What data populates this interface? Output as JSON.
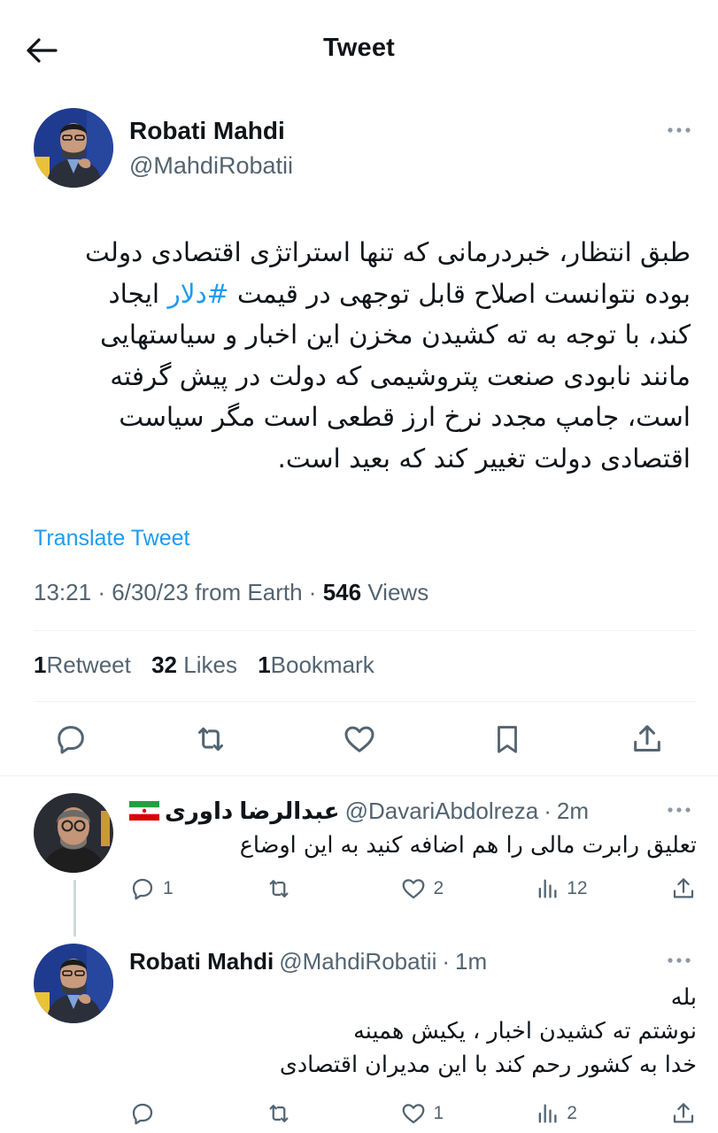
{
  "header": {
    "title": "Tweet",
    "back_icon": "arrow-left-icon"
  },
  "tweet": {
    "author": {
      "name": "Robati Mahdi",
      "handle": "@MahdiRobatii"
    },
    "text_lines": [
      "طبق انتظار، خبردرمانی که تنها استراتژی اقتصادی دولت",
      "بوده نتوانست اصلاح قابل توجهی در قیمت",
      "کند، با توجه به ته کشیدن مخزن این اخبار و سیاستهایی",
      "مانند نابودی صنعت پتروشیمی که دولت در پیش گرفته",
      "است، جامپ مجدد نرخ ارز قطعی است مگر سیاست",
      "اقتصادی دولت تغییر کند که بعید است."
    ],
    "hashtag": "#دلار",
    "line2_tail": "ایجاد",
    "translate_label": "Translate Tweet",
    "time": "13:21",
    "date": "6/30/23",
    "source": "from Earth",
    "views_count": "546",
    "views_label": "Views",
    "retweets_count": "1",
    "retweets_label": "Retweet",
    "likes_count": "32",
    "likes_label": "Likes",
    "bookmarks_count": "1",
    "bookmarks_label": "Bookmark"
  },
  "replies": [
    {
      "name": "عبدالرضا داوری",
      "handle": "@DavariAbdolreza",
      "time": "2m",
      "text_lines": [
        "تعلیق رابرت مالی را هم اضافه کنید به این اوضاع"
      ],
      "reply_count": "1",
      "retweet_count": "",
      "like_count": "2",
      "view_count": "12"
    },
    {
      "name": "Robati Mahdi",
      "handle": "@MahdiRobatii",
      "time": "1m",
      "text_lines": [
        "بله",
        "نوشتم ته کشیدن اخبار ، یکیش همینه",
        "خدا به کشور رحم کند با این مدیران اقتصادی"
      ],
      "reply_count": "",
      "retweet_count": "",
      "like_count": "1",
      "view_count": "2"
    }
  ],
  "colors": {
    "accent": "#1d9bf0",
    "text": "#0f1419",
    "secondary": "#536471",
    "divider": "#eff3f4"
  }
}
